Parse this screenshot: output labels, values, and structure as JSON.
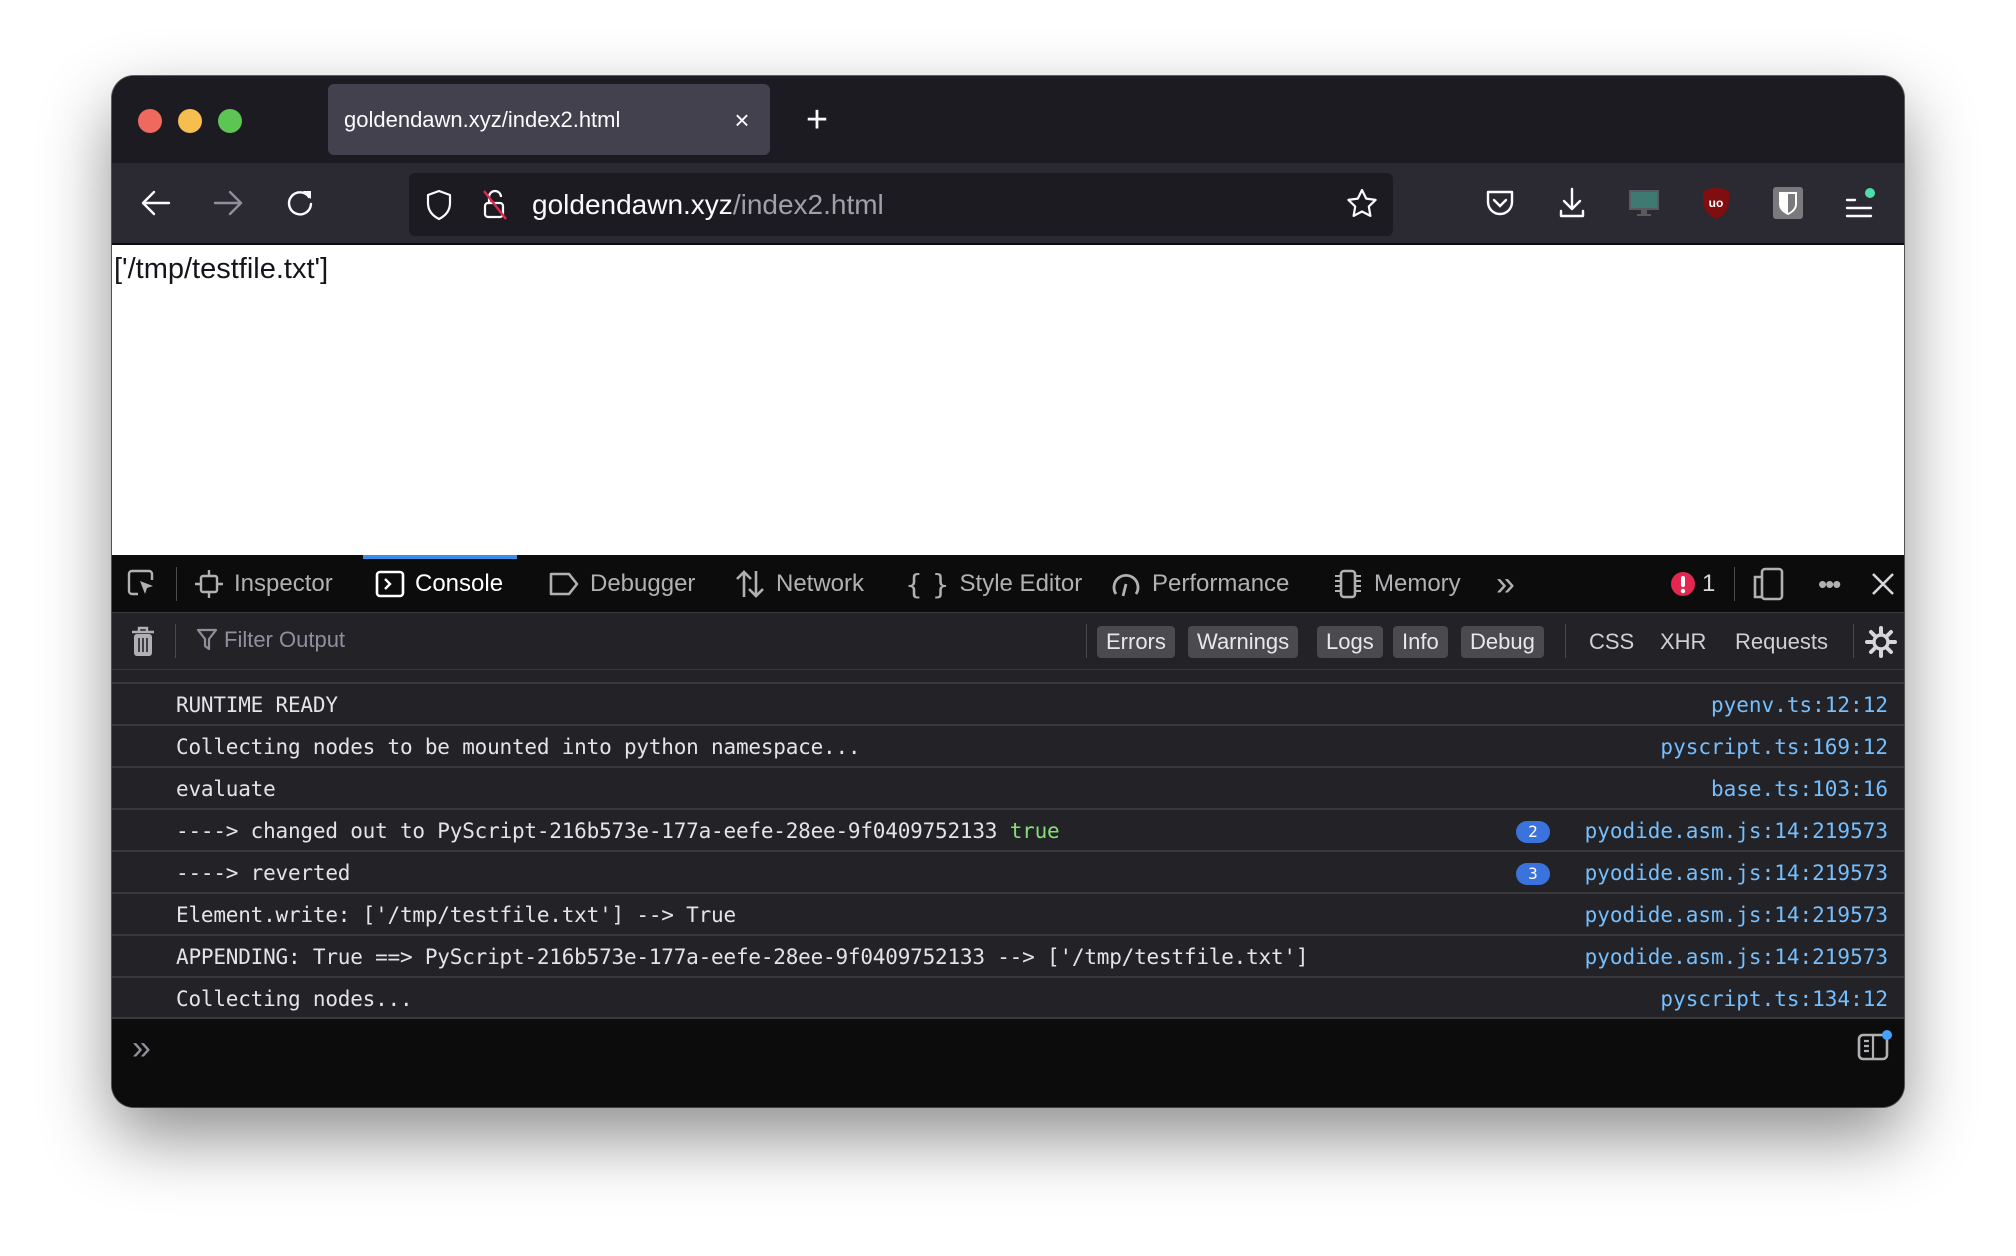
{
  "browser": {
    "tab": {
      "title": "goldendawn.xyz/index2.html",
      "close_icon": "×"
    },
    "new_tab_icon": "+",
    "url": {
      "host": "goldendawn.xyz",
      "path": "/index2.html"
    },
    "toolbar_icons": [
      "back-arrow-icon",
      "forward-arrow-icon",
      "reload-icon",
      "shield-icon",
      "insecure-lock-icon",
      "bookmark-star-icon",
      "pocket-icon",
      "download-icon",
      "monitor-extension-icon",
      "ublock-icon",
      "bitwarden-icon",
      "menu-icon"
    ]
  },
  "page": {
    "text": "['/tmp/testfile.txt']"
  },
  "devtools": {
    "tabs": [
      {
        "label": "Inspector"
      },
      {
        "label": "Console",
        "active": true
      },
      {
        "label": "Debugger"
      },
      {
        "label": "Network"
      },
      {
        "label": "Style Editor"
      },
      {
        "label": "Performance"
      },
      {
        "label": "Memory"
      }
    ],
    "more_tabs_icon": "»",
    "error_count": "1",
    "filter": {
      "placeholder": "Filter Output",
      "levels": [
        "Errors",
        "Warnings",
        "Logs",
        "Info",
        "Debug"
      ],
      "extra": [
        "CSS",
        "XHR",
        "Requests"
      ]
    },
    "console": {
      "rows": [
        {
          "msg": "RUNTIME READY",
          "src": "pyenv.ts:12:12"
        },
        {
          "msg": "Collecting nodes to be mounted into python namespace...",
          "src": "pyscript.ts:169:12"
        },
        {
          "msg": "evaluate",
          "src": "base.ts:103:16"
        },
        {
          "msg": "----> changed out to PyScript-216b573e-177a-eefe-28ee-9f0409752133",
          "value": "true",
          "count": "2",
          "src": "pyodide.asm.js:14:219573"
        },
        {
          "msg": "----> reverted",
          "count": "3",
          "src": "pyodide.asm.js:14:219573"
        },
        {
          "msg": "Element.write: ['/tmp/testfile.txt'] --> True",
          "src": "pyodide.asm.js:14:219573"
        },
        {
          "msg": "APPENDING: True ==> PyScript-216b573e-177a-eefe-28ee-9f0409752133 --> ['/tmp/testfile.txt']",
          "src": "pyodide.asm.js:14:219573"
        },
        {
          "msg": "Collecting nodes...",
          "src": "pyscript.ts:134:12"
        }
      ]
    },
    "prompt_icon": "»"
  },
  "colors": {
    "accent": "#3a8ee6",
    "source_link": "#75bfff",
    "bool_true": "#86de74",
    "error": "#e22850",
    "badge": "#3a73dc"
  }
}
